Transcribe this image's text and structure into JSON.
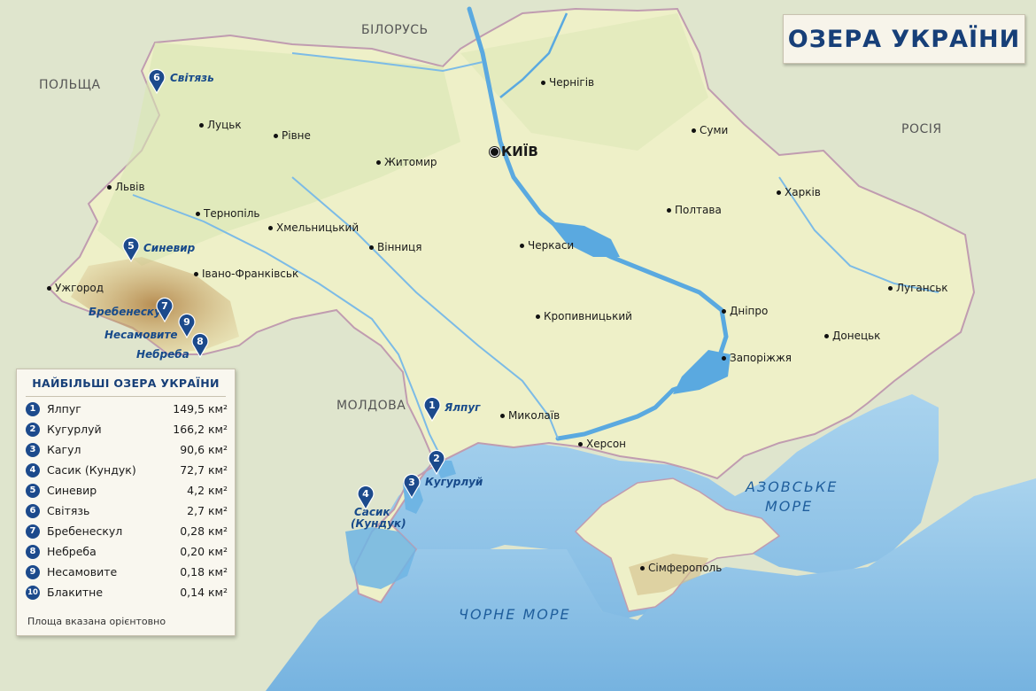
{
  "title": "ОЗЕРА УКРАЇНИ",
  "countries": {
    "belarus": "БІЛОРУСЬ",
    "poland": "ПОЛЬЩА",
    "russia": "РОСІЯ",
    "moldova": "МОЛДОВА"
  },
  "seas": {
    "black": "ЧОРНЕ МОРЕ",
    "azov_line1": "АЗОВСЬКЕ",
    "azov_line2": "МОРЕ"
  },
  "capital": "КИЇВ",
  "cities": {
    "chernihiv": "Чернігів",
    "sumy": "Суми",
    "kharkiv": "Харків",
    "lutsk": "Луцьк",
    "rivne": "Рівне",
    "zhytomyr": "Житомир",
    "lviv": "Львів",
    "ternopil": "Тернопіль",
    "khmelnytskyi": "Хмельницький",
    "poltava": "Полтава",
    "vinnytsia": "Вінниця",
    "cherkasy": "Черкаси",
    "ivano_frankivsk": "Івано-Франківськ",
    "uzhhorod": "Ужгород",
    "luhansk": "Луганськ",
    "dnipro": "Дніпро",
    "kropyvnytskyi": "Кропивницький",
    "donetsk": "Донецьк",
    "zaporizhzhia": "Запоріжжя",
    "mykolaiv": "Миколаїв",
    "kherson": "Херсон",
    "simferopol": "Сімферополь"
  },
  "lake_labels": {
    "svitiaz": "Світязь",
    "synevyr": "Синевир",
    "brebeneskul": "Бребенескул",
    "nesamovyte": "Несамовите",
    "nebreba": "Небреба",
    "yalpuh": "Ялпуг",
    "kuhurluy": "Кугурлуй",
    "sasyk_line1": "Сасик",
    "sasyk_line2": "(Кундук)"
  },
  "pins": {
    "yalpuh": "1",
    "kuhurluy": "2",
    "kahul": "3",
    "sasyk": "4",
    "synevyr": "5",
    "svitiaz": "6",
    "brebeneskul": "7",
    "nebreba": "8",
    "nesamovyte": "9"
  },
  "legend": {
    "title": "НАЙБІЛЬШІ ОЗЕРА УКРАЇНИ",
    "note": "Площа вказана орієнтовно",
    "rows": [
      {
        "num": "1",
        "name": "Ялпуг",
        "area": "149,5 км²"
      },
      {
        "num": "2",
        "name": "Кугурлуй",
        "area": "166,2 км²"
      },
      {
        "num": "3",
        "name": "Кагул",
        "area": "90,6 км²"
      },
      {
        "num": "4",
        "name": "Сасик (Кундук)",
        "area": "72,7 км²"
      },
      {
        "num": "5",
        "name": "Синевир",
        "area": "4,2 км²"
      },
      {
        "num": "6",
        "name": "Світязь",
        "area": "2,7 км²"
      },
      {
        "num": "7",
        "name": "Бребенескул",
        "area": "0,28 км²"
      },
      {
        "num": "8",
        "name": "Небреба",
        "area": "0,20 км²"
      },
      {
        "num": "9",
        "name": "Несамовите",
        "area": "0,18 км²"
      },
      {
        "num": "10",
        "name": "Блакитне",
        "area": "0,14 км²"
      }
    ]
  },
  "colors": {
    "sea": "#8ec3e6",
    "land_ukraine": "#eef0c8",
    "land_neighbors": "#dde3cc",
    "river": "#5aa9e0",
    "mountains": "#c9a66b",
    "accent": "#1c4a8c"
  }
}
